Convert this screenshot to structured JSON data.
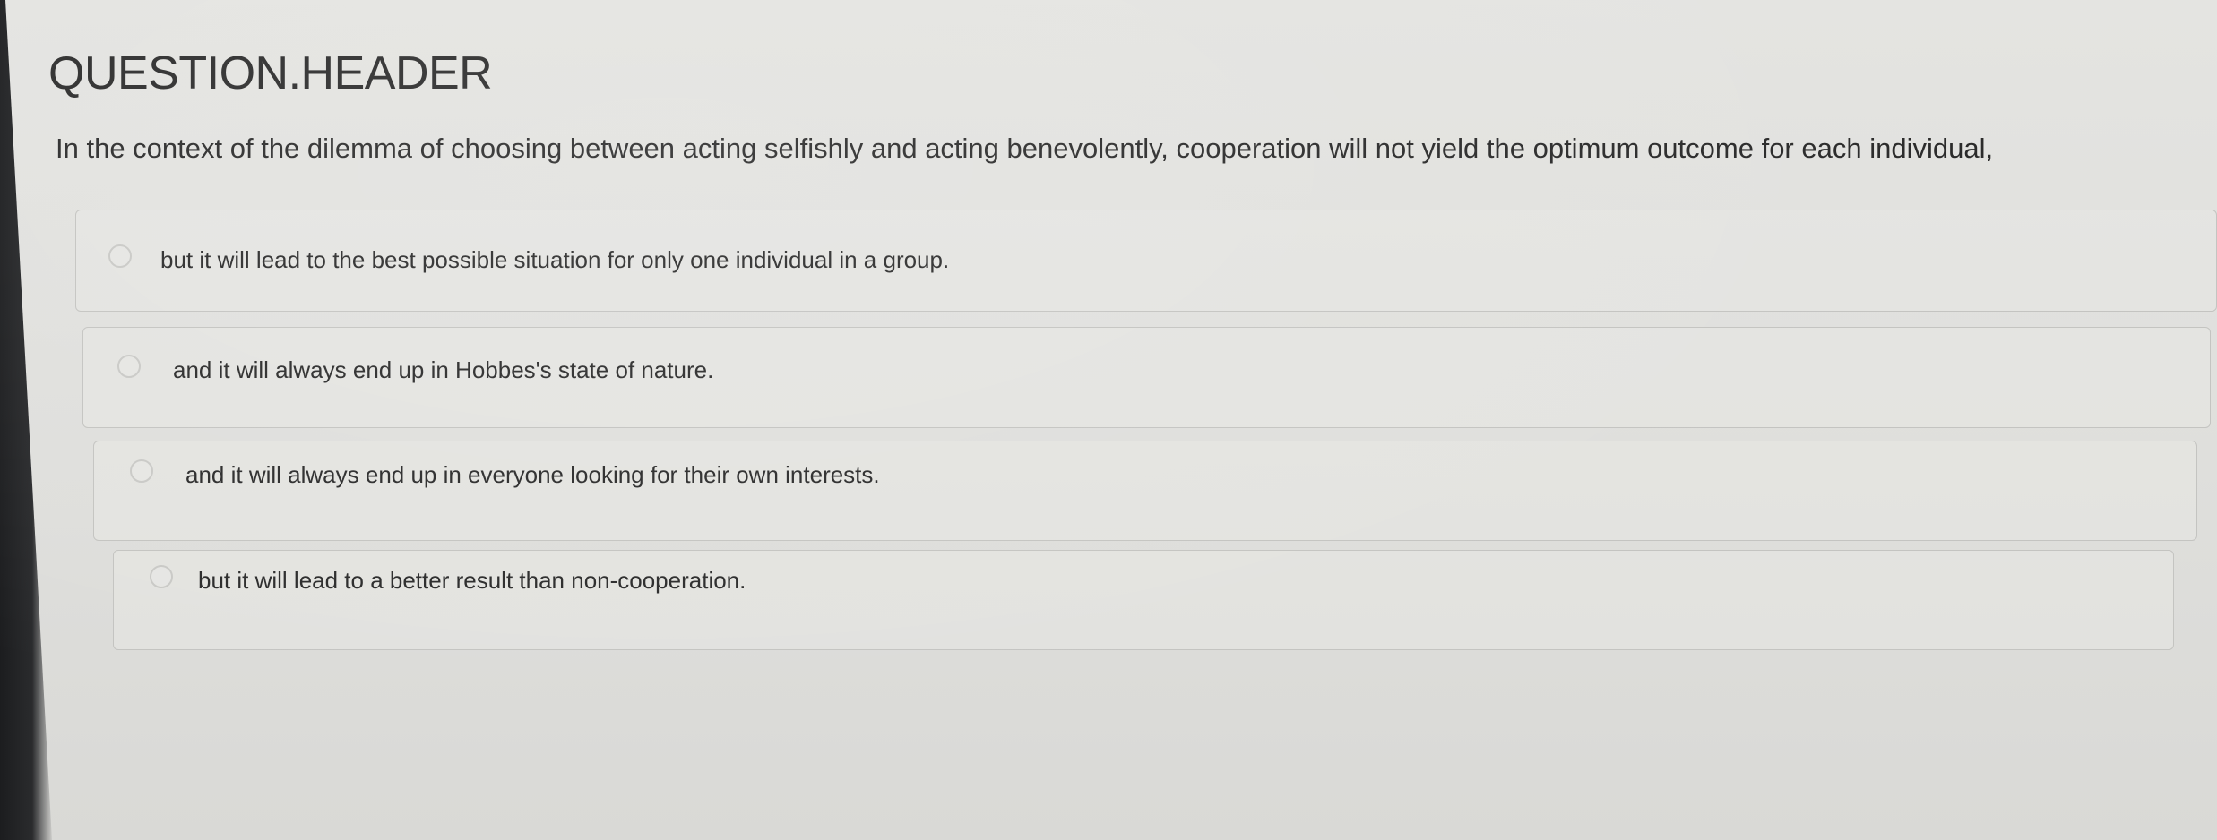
{
  "question": {
    "header": "QUESTION.HEADER",
    "text": "In the context of the dilemma of choosing between acting selfishly and acting benevolently, cooperation will not yield the optimum outcome for each individual,"
  },
  "options": [
    {
      "label": "but it will lead to the best possible situation for only one individual in a group."
    },
    {
      "label": "and it will always end up in Hobbes's state of nature."
    },
    {
      "label": "and it will always end up in everyone looking for their own interests."
    },
    {
      "label": "but it will lead to a better result than non-cooperation."
    }
  ]
}
